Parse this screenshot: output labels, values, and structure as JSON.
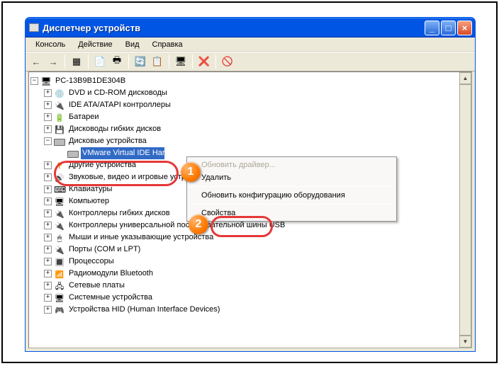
{
  "window": {
    "title": "Диспетчер устройств"
  },
  "menu": {
    "console": "Консоль",
    "action": "Действие",
    "view": "Вид",
    "help": "Справка"
  },
  "tree": {
    "root": "PC-13B9B1DE304B",
    "nodes": [
      {
        "label": "DVD и CD-ROM дисководы",
        "icon": "ic-dvd"
      },
      {
        "label": "IDE ATA/ATAPI контроллеры",
        "icon": "ic-ide"
      },
      {
        "label": "Батареи",
        "icon": "ic-bat"
      },
      {
        "label": "Дисководы гибких дисков",
        "icon": "ic-floppy"
      },
      {
        "label": "Дисковые устройства",
        "icon": "ic-disk"
      },
      {
        "label": "Другие устройства",
        "icon": "ic-other"
      },
      {
        "label": "Звуковые, видео и игровые устройства",
        "icon": "ic-sound"
      },
      {
        "label": "Клавиатуры",
        "icon": "ic-kbd"
      },
      {
        "label": "Компьютер",
        "icon": "ic-comp"
      },
      {
        "label": "Контроллеры гибких дисков",
        "icon": "ic-flop2"
      },
      {
        "label": "Контроллеры универсальной последовательной шины USB",
        "icon": "ic-usb"
      },
      {
        "label": "Мыши и иные указывающие устройства",
        "icon": "ic-mouse"
      },
      {
        "label": "Порты (COM и LPT)",
        "icon": "ic-port"
      },
      {
        "label": "Процессоры",
        "icon": "ic-cpu"
      },
      {
        "label": "Радиомодули Bluetooth",
        "icon": "ic-bt"
      },
      {
        "label": "Сетевые платы",
        "icon": "ic-net"
      },
      {
        "label": "Системные устройства",
        "icon": "ic-sys"
      },
      {
        "label": "Устройства HID (Human Interface Devices)",
        "icon": "ic-hid"
      }
    ],
    "selected_child": "VMware Virtual IDE Hard Drive"
  },
  "context_menu": {
    "update_driver": "Обновить драйвер...",
    "delete": "Удалить",
    "refresh_config": "Обновить конфигурацию оборудования",
    "properties": "Свойства"
  },
  "badges": {
    "one": "1",
    "two": "2"
  },
  "expanders": {
    "plus": "+",
    "minus": "−"
  }
}
